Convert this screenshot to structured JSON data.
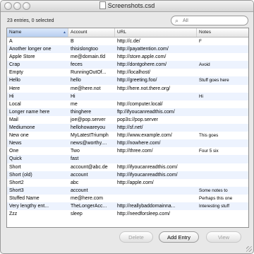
{
  "window": {
    "title": "Screenshots.csd"
  },
  "toolbar": {
    "status": "23 entries, 0 selected",
    "search_placeholder": "All"
  },
  "table": {
    "columns": [
      "Name",
      "Account",
      "URL",
      "Notes"
    ],
    "rows": [
      {
        "name": "A",
        "account": "B",
        "url": "http://c.de/",
        "notes": "F"
      },
      {
        "name": "Another longer one",
        "account": "thisislongtoo",
        "url": "http://payattention.com/",
        "notes": ""
      },
      {
        "name": "Apple Store",
        "account": "me@domain.tld",
        "url": "http://store.apple.com/",
        "notes": ""
      },
      {
        "name": "Crap",
        "account": "feces",
        "url": "http://dontgohere.com/",
        "notes": "Avoid"
      },
      {
        "name": "Empty",
        "account": "RunningOutOf...",
        "url": "http://localhost/",
        "notes": ""
      },
      {
        "name": "Hello",
        "account": "hello",
        "url": "http://greeting.foo/",
        "notes": "Stuff goes here"
      },
      {
        "name": "Here",
        "account": "me@here.not",
        "url": "http://here.not.there.org/",
        "notes": ""
      },
      {
        "name": "Hi",
        "account": "Hi",
        "url": "",
        "notes": "Hi"
      },
      {
        "name": "Local",
        "account": "me",
        "url": "http://computer.local/",
        "notes": ""
      },
      {
        "name": "Longer name here",
        "account": "thinghere",
        "url": "ftp://ifyoucanreadthis.com/",
        "notes": ""
      },
      {
        "name": "Mail",
        "account": "joe@pop.server",
        "url": "pop3s://pop.server",
        "notes": ""
      },
      {
        "name": "Mediumone",
        "account": "hellohowareyou",
        "url": "http://sf.net/",
        "notes": ""
      },
      {
        "name": "New one",
        "account": "MyLatestTriumph",
        "url": "http://www.example.com/",
        "notes": "This goes"
      },
      {
        "name": "News",
        "account": "news@worthy....",
        "url": "http://nowhere.com/",
        "notes": ""
      },
      {
        "name": "One",
        "account": "Two",
        "url": "http://three.com/",
        "notes": "Four 5 six"
      },
      {
        "name": "Quick",
        "account": "fast",
        "url": "",
        "notes": ""
      },
      {
        "name": "Short",
        "account": "account@abc.de",
        "url": "http://ifyoucanreadthis.com/",
        "notes": ""
      },
      {
        "name": "Short (old)",
        "account": "account",
        "url": "http://ifyoucanreadthis.com/",
        "notes": ""
      },
      {
        "name": "Short2",
        "account": "abc",
        "url": "http://apple.com/",
        "notes": ""
      },
      {
        "name": "Short3",
        "account": "account",
        "url": "",
        "notes": "Some notes to"
      },
      {
        "name": "Stuffed Name",
        "account": "me@here.com",
        "url": "",
        "notes": "Perhaps this one"
      },
      {
        "name": "Very lengthy ent...",
        "account": "TheLongerAcc...",
        "url": "http://reallybaddomainna...",
        "notes": "Interesting stuff"
      },
      {
        "name": "Zzz",
        "account": "sleep",
        "url": "http://needforsleep.com/",
        "notes": ""
      }
    ]
  },
  "buttons": {
    "delete": "Delete",
    "add_entry": "Add Entry",
    "view": "View"
  }
}
